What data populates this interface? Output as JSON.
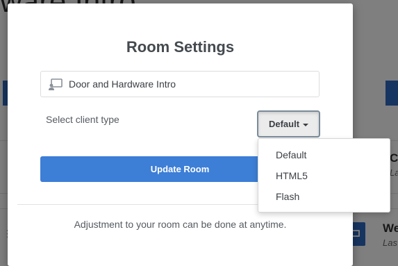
{
  "background": {
    "page_title": "ware Intro",
    "right_text_1": "Co",
    "right_text_2": "Las",
    "right_text_3": "We",
    "right_text_4": "Las"
  },
  "modal": {
    "title": "Room Settings",
    "room_name_value": "Door and Hardware Intro",
    "client_type_label": "Select client type",
    "client_type_button": "Default",
    "update_button": "Update Room",
    "footer_text": "Adjustment to your room can be done at anytime."
  },
  "client_type_menu": {
    "options": [
      "Default",
      "HTML5",
      "Flash"
    ]
  },
  "icons": {
    "room": "presentation-screen-icon",
    "dropdown": "caret-down-icon"
  },
  "colors": {
    "primary_button": "#3d7ed6",
    "overlay": "rgba(0,0,0,0.5)"
  }
}
